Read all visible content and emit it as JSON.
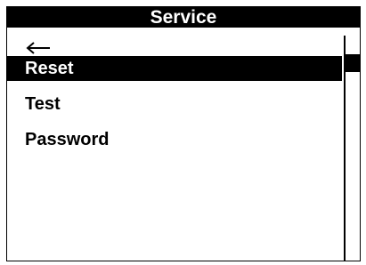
{
  "header": {
    "title": "Service"
  },
  "navigation": {
    "back_icon": "arrow-left-icon"
  },
  "menu": {
    "items": [
      {
        "label": "Reset",
        "selected": true
      },
      {
        "label": "Test",
        "selected": false
      },
      {
        "label": "Password",
        "selected": false
      }
    ]
  },
  "scrollbar": {
    "position_fraction": 0.0
  },
  "colors": {
    "background": "#ffffff",
    "foreground": "#000000"
  }
}
